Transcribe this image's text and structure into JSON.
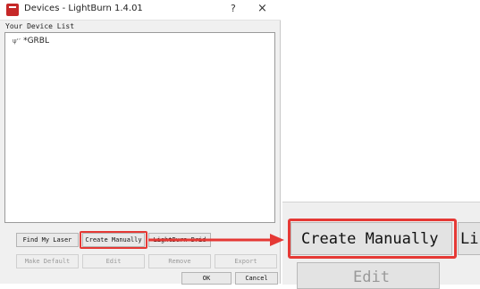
{
  "window": {
    "title": "Devices - LightBurn 1.4.01",
    "help_label": "?",
    "close_label": "×"
  },
  "device_list": {
    "caption": "Your Device List",
    "items": [
      {
        "signal_label": "ψ‘’",
        "name": "*GRBL"
      }
    ]
  },
  "buttons_row1": {
    "find_my_laser": "Find My Laser",
    "create_manually": "Create Manually",
    "lightburn_bridge": "LightBurn Brid"
  },
  "buttons_row2": {
    "make_default": "Make Default",
    "edit": "Edit",
    "remove": "Remove",
    "export": "Export"
  },
  "buttons_row3": {
    "ok": "OK",
    "cancel": "Cancel"
  },
  "zoomed": {
    "create_manually": "Create Manually",
    "next_partial": "Li",
    "edit_partial": "Edit"
  },
  "colors": {
    "highlight": "#e53935",
    "app_icon": "#c62828"
  }
}
